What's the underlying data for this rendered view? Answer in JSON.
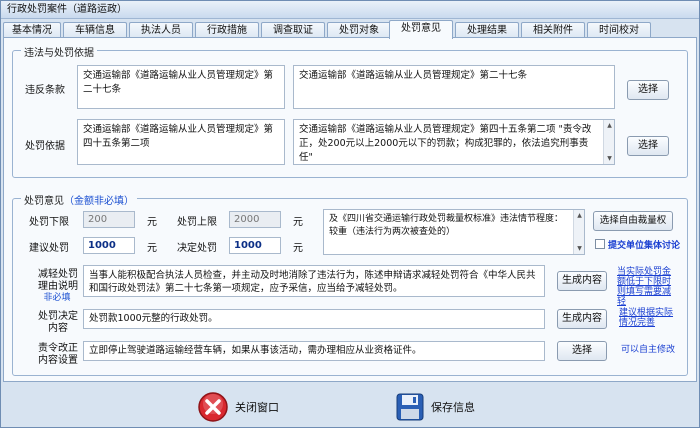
{
  "window": {
    "title": "行政处罚案件（道路运政）"
  },
  "tabs": [
    "基本情况",
    "车辆信息",
    "执法人员",
    "行政措施",
    "调查取证",
    "处罚对象",
    "处罚意见",
    "处理结果",
    "相关附件",
    "时间校对"
  ],
  "basis": {
    "legend": "违法与处罚依据",
    "violation": {
      "label": "违反条款",
      "left_text": "交通运输部《道路运输从业人员管理规定》第二十七条",
      "right_text": "交通运输部《道路运输从业人员管理规定》第二十七条",
      "button": "选择"
    },
    "penalty": {
      "label": "处罚依据",
      "left_text": "交通运输部《道路运输从业人员管理规定》第四十五条第二项",
      "right_text": "交通运输部《道路运输从业人员管理规定》第四十五条第二项 \"责令改正，处200元以上2000元以下的罚款；构成犯罪的，依法追究刑事责任\"",
      "button": "选择"
    }
  },
  "opinion": {
    "legend": "处罚意见",
    "legend_note": "（金额非必填）",
    "lower_label": "处罚下限",
    "lower_value": "200",
    "upper_label": "处罚上限",
    "upper_value": "2000",
    "unit": "元",
    "suggest_label": "建议处罚",
    "suggest_value": "1000",
    "decide_label": "决定处罚",
    "decide_value": "1000",
    "standard_text": "及《四川省交通运输行政处罚裁量权标准》违法情节程度：较重（违法行为两次被查处的）",
    "standard_button": "选择自由裁量权",
    "collective_label": "提交单位集体讨论",
    "mitigate_label_1": "减轻处罚",
    "mitigate_label_2": "理由说明",
    "mitigate_req": "非必填",
    "mitigate_text": "当事人能积极配合执法人员检查，并主动及时地消除了违法行为，陈述申辩请求减轻处罚符合《中华人民共和国行政处罚法》第二十七条第一项规定，应予采信，应当给予减轻处罚。",
    "mitigate_button": "生成内容",
    "mitigate_link": "当实际处罚金额低于下限时则填写需要减轻",
    "decision_label_1": "处罚决定",
    "decision_label_2": "内容",
    "decision_text": "处罚款1000元整的行政处罚。",
    "decision_button": "生成内容",
    "decision_link": "建议根据实际情况完善",
    "correction_label_1": "责令改正",
    "correction_label_2": "内容设置",
    "correction_text": "立即停止驾驶道路运输经营车辆，如果从事该活动，需办理相应从业资格证件。",
    "correction_button": "选择",
    "correction_link": "可以自主修改"
  },
  "footer": {
    "close_label": "关闭窗口",
    "save_label": "保存信息"
  },
  "colors": {
    "link": "#1a3fd1",
    "close_icon": "#d9282f",
    "save_icon": "#2a5fb5"
  }
}
